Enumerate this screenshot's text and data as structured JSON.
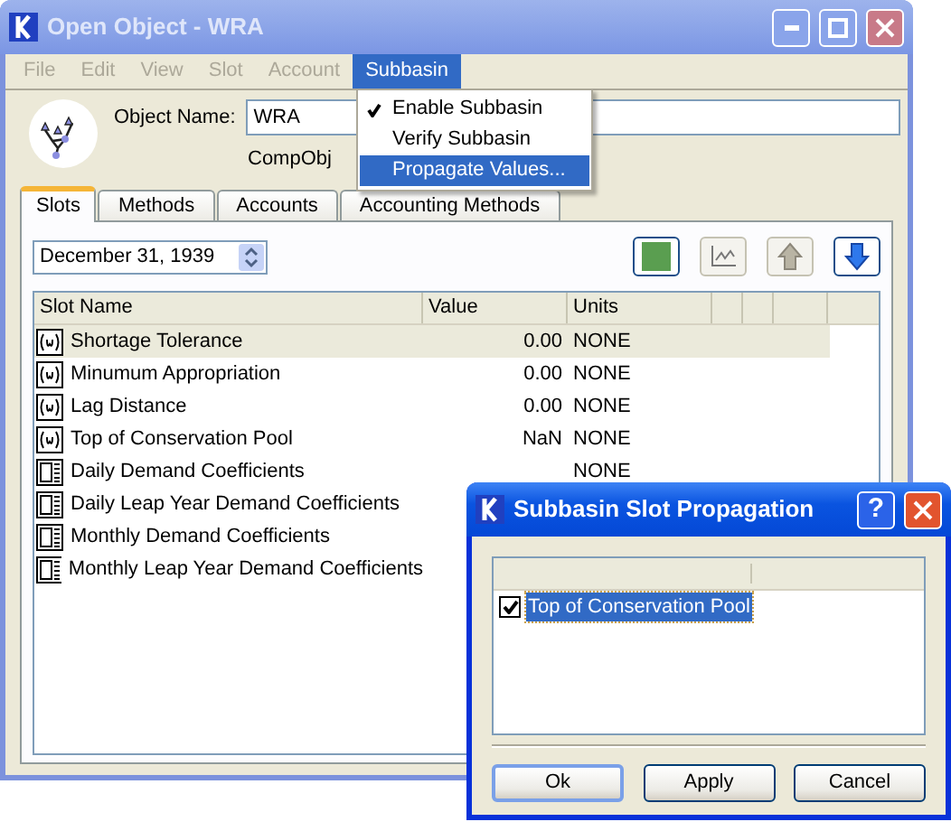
{
  "window": {
    "title": "Open Object - WRA"
  },
  "menu_bar": [
    {
      "label": "File",
      "disabled": true,
      "selected": false
    },
    {
      "label": "Edit",
      "disabled": true,
      "selected": false
    },
    {
      "label": "View",
      "disabled": true,
      "selected": false
    },
    {
      "label": "Slot",
      "disabled": true,
      "selected": false
    },
    {
      "label": "Account",
      "disabled": true,
      "selected": false
    },
    {
      "label": "Subbasin",
      "disabled": false,
      "selected": true
    }
  ],
  "menu": {
    "items": [
      {
        "label": "Enable Subbasin",
        "checked": true,
        "selected": false
      },
      {
        "label": "Verify Subbasin",
        "checked": false,
        "selected": false
      },
      {
        "label": "Propagate Values...",
        "checked": false,
        "selected": true
      }
    ]
  },
  "object": {
    "name_label": "Object Name:",
    "name": "WRA",
    "type": "CompObj"
  },
  "tabs": [
    {
      "label": "Slots",
      "selected": true
    },
    {
      "label": "Methods",
      "selected": false
    },
    {
      "label": "Accounts",
      "selected": false
    },
    {
      "label": "Accounting Methods",
      "selected": false
    }
  ],
  "date": "December 31, 1939",
  "table": {
    "columns": [
      "Slot Name",
      "Value",
      "Units"
    ],
    "rows": [
      {
        "kind": "scalar",
        "name": "Shortage Tolerance",
        "value": "0.00",
        "units": "NONE",
        "selected": true
      },
      {
        "kind": "scalar",
        "name": "Minumum Appropriation",
        "value": "0.00",
        "units": "NONE",
        "selected": false
      },
      {
        "kind": "scalar",
        "name": "Lag Distance",
        "value": "0.00",
        "units": "NONE",
        "selected": false
      },
      {
        "kind": "scalar",
        "name": "Top of Conservation Pool",
        "value": "NaN",
        "units": "NONE",
        "selected": false
      },
      {
        "kind": "periodic",
        "name": "Daily Demand Coefficients",
        "units": "NONE",
        "selected": false
      },
      {
        "kind": "periodic",
        "name": "Daily Leap Year Demand Coefficients",
        "selected": false
      },
      {
        "kind": "periodic",
        "name": "Monthly Demand Coefficients",
        "selected": false
      },
      {
        "kind": "periodic",
        "name": "Monthly Leap Year Demand Coefficients",
        "selected": false
      }
    ]
  },
  "dialog": {
    "title": "Subbasin Slot Propagation",
    "help": "?",
    "items": [
      {
        "label": "Top of Conservation Pool",
        "checked": true,
        "selected": true
      }
    ],
    "buttons": [
      "Ok",
      "Apply",
      "Cancel"
    ]
  }
}
